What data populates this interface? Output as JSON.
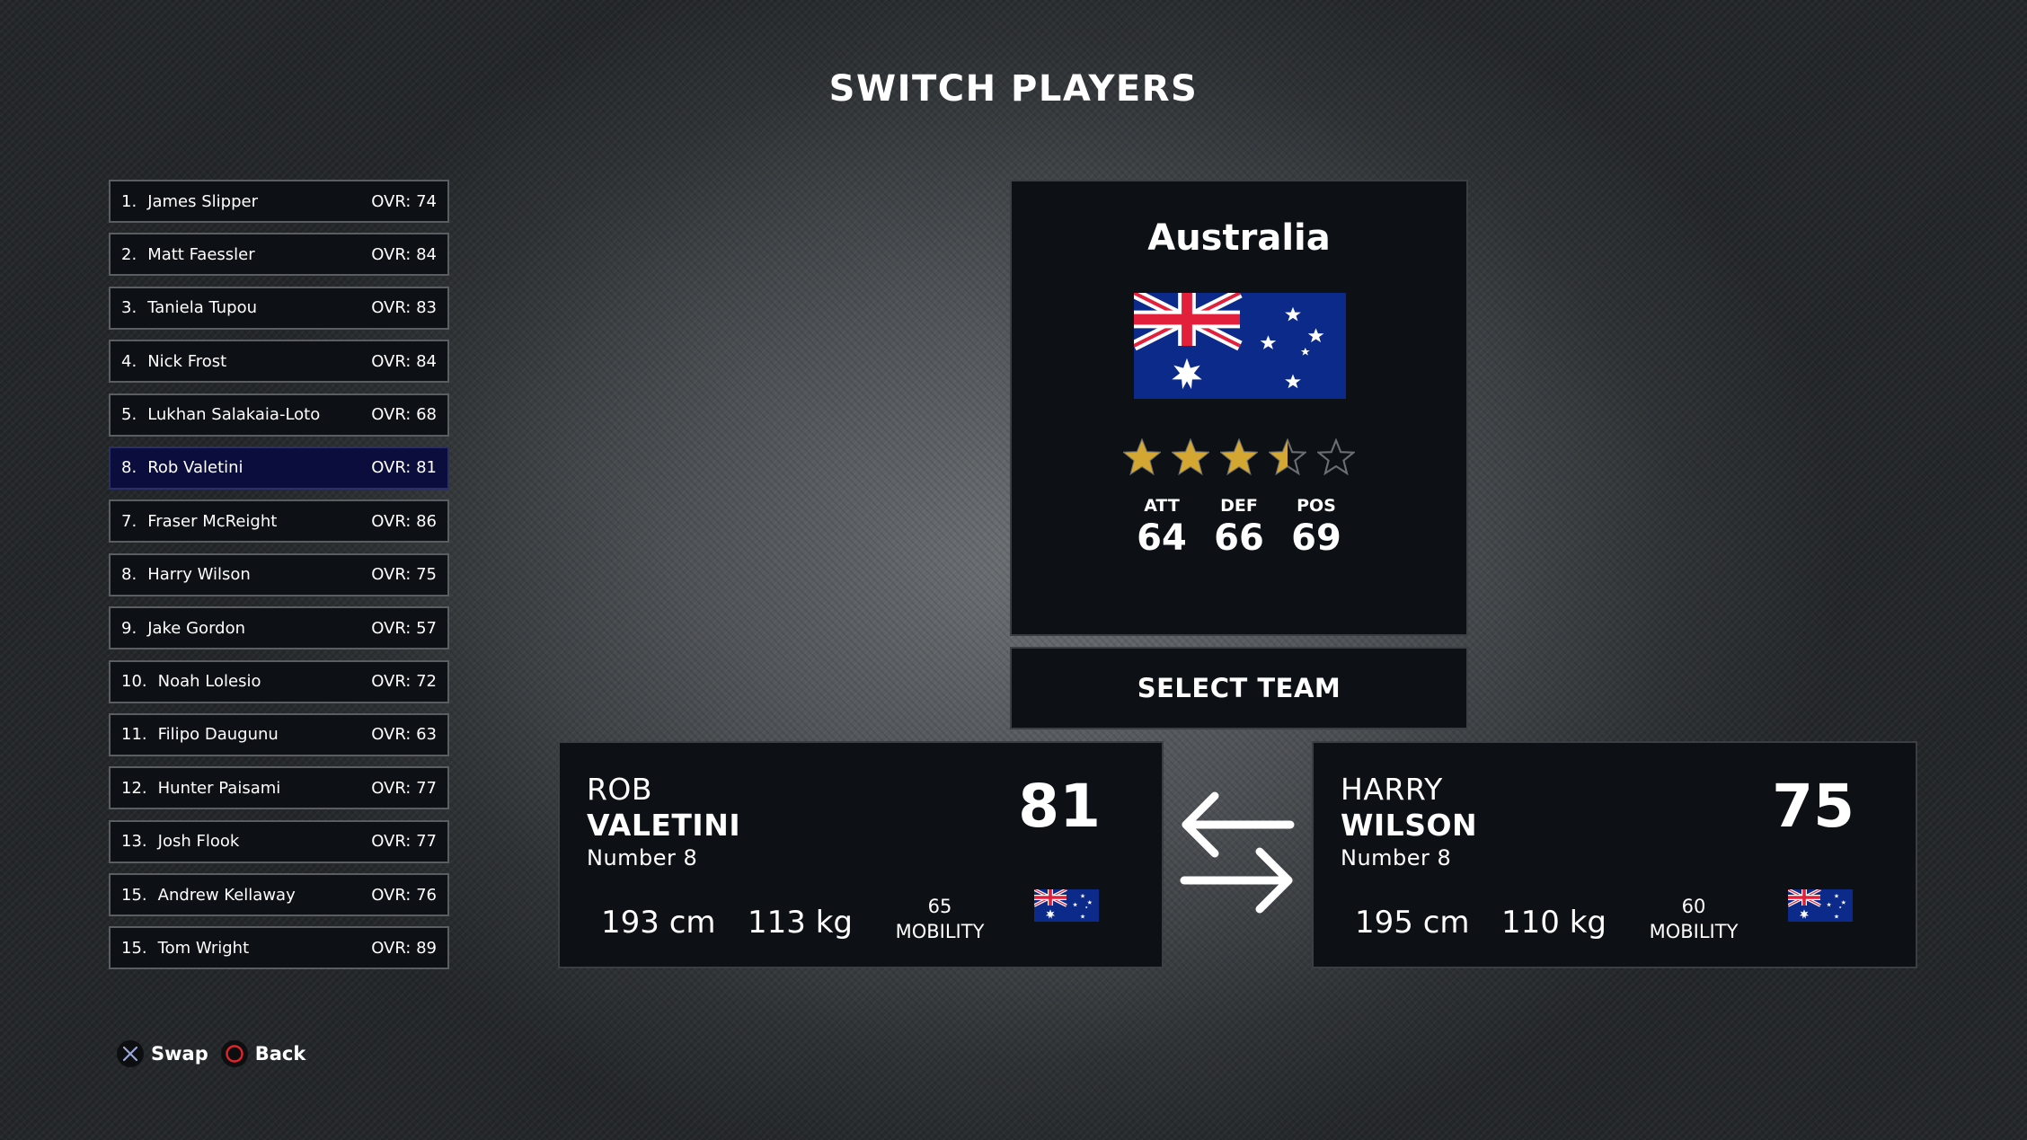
{
  "title": "SWITCH PLAYERS",
  "roster": [
    {
      "num": "1.",
      "name": "James Slipper",
      "ovr": "OVR: 74"
    },
    {
      "num": "2.",
      "name": "Matt Faessler",
      "ovr": "OVR: 84"
    },
    {
      "num": "3.",
      "name": "Taniela Tupou",
      "ovr": "OVR: 83"
    },
    {
      "num": "4.",
      "name": "Nick Frost",
      "ovr": "OVR: 84"
    },
    {
      "num": "5.",
      "name": "Lukhan Salakaia-Loto",
      "ovr": "OVR: 68"
    },
    {
      "num": "8.",
      "name": "Rob Valetini",
      "ovr": "OVR: 81",
      "selected": true
    },
    {
      "num": "7.",
      "name": "Fraser McReight",
      "ovr": "OVR: 86"
    },
    {
      "num": "8.",
      "name": "Harry Wilson",
      "ovr": "OVR: 75"
    },
    {
      "num": "9.",
      "name": "Jake Gordon",
      "ovr": "OVR: 57"
    },
    {
      "num": "10.",
      "name": "Noah Lolesio",
      "ovr": "OVR: 72"
    },
    {
      "num": "11.",
      "name": "Filipo Daugunu",
      "ovr": "OVR: 63"
    },
    {
      "num": "12.",
      "name": "Hunter Paisami",
      "ovr": "OVR: 77"
    },
    {
      "num": "13.",
      "name": "Josh Flook",
      "ovr": "OVR: 77"
    },
    {
      "num": "15.",
      "name": "Andrew Kellaway",
      "ovr": "OVR: 76"
    },
    {
      "num": "15.",
      "name": "Tom Wright",
      "ovr": "OVR: 89"
    }
  ],
  "team": {
    "name": "Australia",
    "flag_icon": "australia-flag-icon",
    "star_rating": 3.5,
    "star_max": 5,
    "star_color": "#d4a733",
    "stats": [
      {
        "label": "ATT",
        "value": "64"
      },
      {
        "label": "DEF",
        "value": "66"
      },
      {
        "label": "POS",
        "value": "69"
      }
    ]
  },
  "select_team_label": "SELECT TEAM",
  "player_left": {
    "first_name": "ROB",
    "last_name": "VALETINI",
    "number": "Number 8",
    "rating": "81",
    "height": "193 cm",
    "weight": "113 kg",
    "mobility_value": "65",
    "mobility_label": "MOBILITY",
    "flag_icon": "australia-flag-icon"
  },
  "player_right": {
    "first_name": "HARRY",
    "last_name": "WILSON",
    "number": "Number 8",
    "rating": "75",
    "height": "195 cm",
    "weight": "110 kg",
    "mobility_value": "60",
    "mobility_label": "MOBILITY",
    "flag_icon": "australia-flag-icon"
  },
  "swap_icon": "swap-arrows-icon",
  "controls": [
    {
      "icon": "cross-button-icon",
      "label": "Swap"
    },
    {
      "icon": "circle-button-icon",
      "label": "Back"
    }
  ],
  "colors": {
    "selected_row": "#0b0d3c",
    "panel": "#0d1014",
    "circle_button": "#e0242c",
    "cross_button": "#9aa6d8"
  }
}
